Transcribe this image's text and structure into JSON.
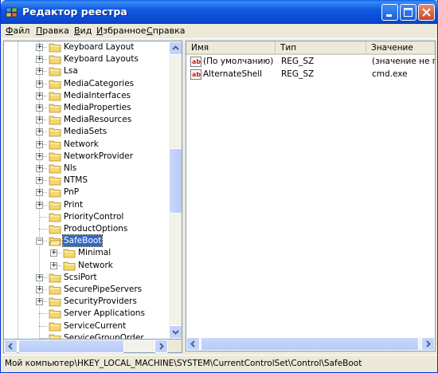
{
  "window": {
    "title": "Редактор реестра"
  },
  "menu": [
    "Файл",
    "Правка",
    "Вид",
    "Избранное",
    "Справка"
  ],
  "menu_underline": [
    "Ф",
    "П",
    "В",
    "И",
    "С"
  ],
  "tree": [
    {
      "label": "Keyboard Layout",
      "expand": "+",
      "level": 0
    },
    {
      "label": "Keyboard Layouts",
      "expand": "+",
      "level": 0
    },
    {
      "label": "Lsa",
      "expand": "+",
      "level": 0
    },
    {
      "label": "MediaCategories",
      "expand": "+",
      "level": 0
    },
    {
      "label": "MediaInterfaces",
      "expand": "+",
      "level": 0
    },
    {
      "label": "MediaProperties",
      "expand": "+",
      "level": 0
    },
    {
      "label": "MediaResources",
      "expand": "+",
      "level": 0
    },
    {
      "label": "MediaSets",
      "expand": "+",
      "level": 0
    },
    {
      "label": "Network",
      "expand": "+",
      "level": 0
    },
    {
      "label": "NetworkProvider",
      "expand": "+",
      "level": 0
    },
    {
      "label": "Nls",
      "expand": "+",
      "level": 0
    },
    {
      "label": "NTMS",
      "expand": "+",
      "level": 0
    },
    {
      "label": "PnP",
      "expand": "+",
      "level": 0
    },
    {
      "label": "Print",
      "expand": "+",
      "level": 0
    },
    {
      "label": "PriorityControl",
      "expand": "",
      "level": 0
    },
    {
      "label": "ProductOptions",
      "expand": "",
      "level": 0
    },
    {
      "label": "SafeBoot",
      "expand": "−",
      "level": 0,
      "selected": true,
      "open": true
    },
    {
      "label": "Minimal",
      "expand": "+",
      "level": 1
    },
    {
      "label": "Network",
      "expand": "+",
      "level": 1
    },
    {
      "label": "ScsiPort",
      "expand": "+",
      "level": 0
    },
    {
      "label": "SecurePipeServers",
      "expand": "+",
      "level": 0
    },
    {
      "label": "SecurityProviders",
      "expand": "+",
      "level": 0
    },
    {
      "label": "Server Applications",
      "expand": "",
      "level": 0
    },
    {
      "label": "ServiceCurrent",
      "expand": "",
      "level": 0
    },
    {
      "label": "ServiceGroupOrder",
      "expand": "",
      "level": 0
    }
  ],
  "columns": [
    "Имя",
    "Тип",
    "Значение"
  ],
  "values": [
    {
      "name": "(По умолчанию)",
      "type": "REG_SZ",
      "data": "(значение не присвоено)"
    },
    {
      "name": "AlternateShell",
      "type": "REG_SZ",
      "data": "cmd.exe"
    }
  ],
  "status": "Мой компьютер\\HKEY_LOCAL_MACHINE\\SYSTEM\\CurrentControlSet\\Control\\SafeBoot",
  "colors": {
    "title_blue": "#0a48cf",
    "selection": "#316ac5",
    "folder": "#f5d76e"
  }
}
